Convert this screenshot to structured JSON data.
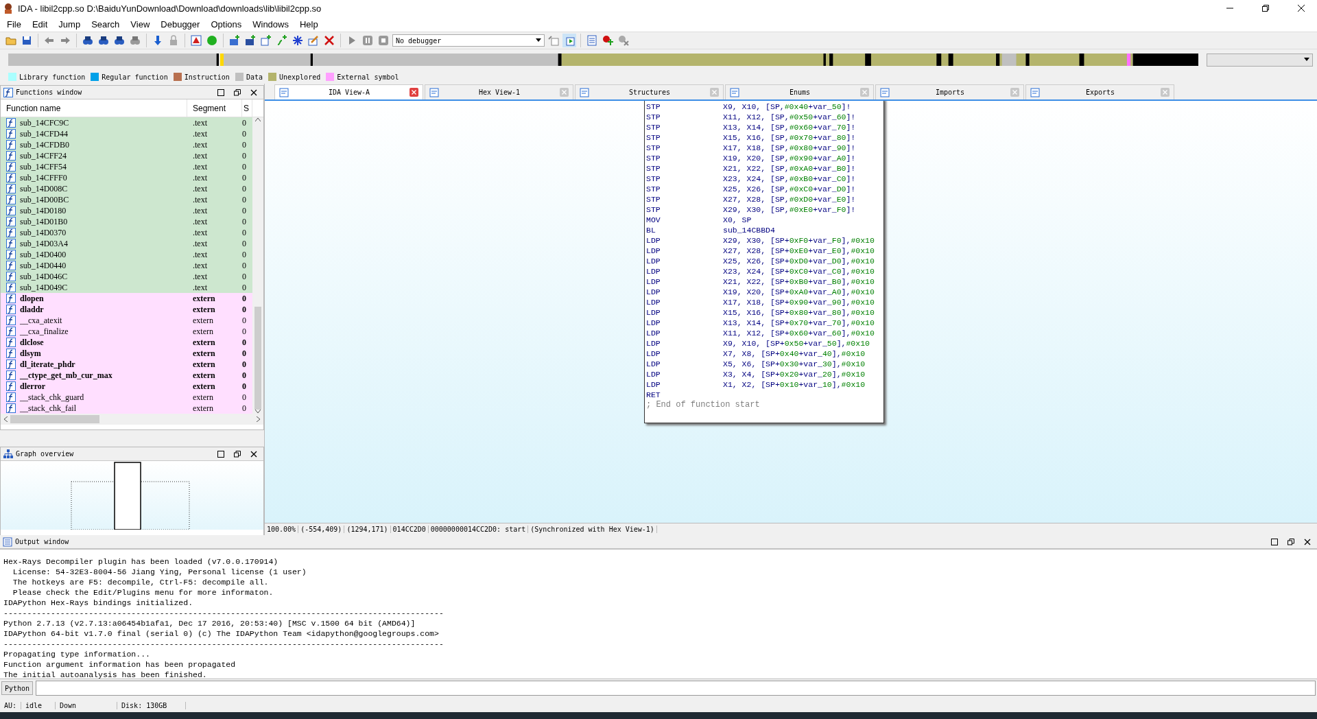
{
  "window": {
    "title": "IDA - libil2cpp.so D:\\BaiduYunDownload\\Download\\downloads\\lib\\libil2cpp.so"
  },
  "menu": [
    "File",
    "Edit",
    "Jump",
    "Search",
    "View",
    "Debugger",
    "Options",
    "Windows",
    "Help"
  ],
  "toolbar": {
    "debugger_select": "No debugger"
  },
  "legend": [
    {
      "label": "Library function",
      "color": "#aaffff"
    },
    {
      "label": "Regular function",
      "color": "#00a0e8"
    },
    {
      "label": "Instruction",
      "color": "#b87050"
    },
    {
      "label": "Data",
      "color": "#c0c0c0"
    },
    {
      "label": "Unexplored",
      "color": "#b4b46c"
    },
    {
      "label": "External symbol",
      "color": "#ffa0ff"
    }
  ],
  "functions_window": {
    "title": "Functions window",
    "columns": [
      "Function name",
      "Segment",
      "S"
    ],
    "rows": [
      {
        "name": "sub_14CFC9C",
        "segment": ".text",
        "column_3": "0",
        "kind": "code",
        "bold": false
      },
      {
        "name": "sub_14CFD44",
        "segment": ".text",
        "column_3": "0",
        "kind": "code",
        "bold": false
      },
      {
        "name": "sub_14CFDB0",
        "segment": ".text",
        "column_3": "0",
        "kind": "code",
        "bold": false
      },
      {
        "name": "sub_14CFF24",
        "segment": ".text",
        "column_3": "0",
        "kind": "code",
        "bold": false
      },
      {
        "name": "sub_14CFF54",
        "segment": ".text",
        "column_3": "0",
        "kind": "code",
        "bold": false
      },
      {
        "name": "sub_14CFFF0",
        "segment": ".text",
        "column_3": "0",
        "kind": "code",
        "bold": false
      },
      {
        "name": "sub_14D008C",
        "segment": ".text",
        "column_3": "0",
        "kind": "code",
        "bold": false
      },
      {
        "name": "sub_14D00BC",
        "segment": ".text",
        "column_3": "0",
        "kind": "code",
        "bold": false
      },
      {
        "name": "sub_14D0180",
        "segment": ".text",
        "column_3": "0",
        "kind": "code",
        "bold": false
      },
      {
        "name": "sub_14D01B0",
        "segment": ".text",
        "column_3": "0",
        "kind": "code",
        "bold": false
      },
      {
        "name": "sub_14D0370",
        "segment": ".text",
        "column_3": "0",
        "kind": "code",
        "bold": false
      },
      {
        "name": "sub_14D03A4",
        "segment": ".text",
        "column_3": "0",
        "kind": "code",
        "bold": false
      },
      {
        "name": "sub_14D0400",
        "segment": ".text",
        "column_3": "0",
        "kind": "code",
        "bold": false
      },
      {
        "name": "sub_14D0440",
        "segment": ".text",
        "column_3": "0",
        "kind": "code",
        "bold": false
      },
      {
        "name": "sub_14D046C",
        "segment": ".text",
        "column_3": "0",
        "kind": "code",
        "bold": false
      },
      {
        "name": "sub_14D049C",
        "segment": ".text",
        "column_3": "0",
        "kind": "code",
        "bold": false
      },
      {
        "name": "dlopen",
        "segment": "extern",
        "column_3": "0",
        "kind": "extern",
        "bold": true
      },
      {
        "name": "dladdr",
        "segment": "extern",
        "column_3": "0",
        "kind": "extern",
        "bold": true
      },
      {
        "name": "__cxa_atexit",
        "segment": "extern",
        "column_3": "0",
        "kind": "extern",
        "bold": false
      },
      {
        "name": "__cxa_finalize",
        "segment": "extern",
        "column_3": "0",
        "kind": "extern",
        "bold": false
      },
      {
        "name": "dlclose",
        "segment": "extern",
        "column_3": "0",
        "kind": "extern",
        "bold": true
      },
      {
        "name": "dlsym",
        "segment": "extern",
        "column_3": "0",
        "kind": "extern",
        "bold": true
      },
      {
        "name": "dl_iterate_phdr",
        "segment": "extern",
        "column_3": "0",
        "kind": "extern",
        "bold": true
      },
      {
        "name": "__ctype_get_mb_cur_max",
        "segment": "extern",
        "column_3": "0",
        "kind": "extern",
        "bold": true
      },
      {
        "name": "dlerror",
        "segment": "extern",
        "column_3": "0",
        "kind": "extern",
        "bold": true
      },
      {
        "name": "__stack_chk_guard",
        "segment": "extern",
        "column_3": "0",
        "kind": "extern",
        "bold": false
      },
      {
        "name": "__stack_chk_fail",
        "segment": "extern",
        "column_3": "0",
        "kind": "extern",
        "bold": false
      }
    ]
  },
  "graph_overview": {
    "title": "Graph overview"
  },
  "tabs": [
    {
      "label": "IDA View-A",
      "selected": true
    },
    {
      "label": "Hex View-1",
      "selected": false
    },
    {
      "label": "Structures",
      "selected": false
    },
    {
      "label": "Enums",
      "selected": false
    },
    {
      "label": "Imports",
      "selected": false
    },
    {
      "label": "Exports",
      "selected": false
    }
  ],
  "code": [
    {
      "mnemonic": "STP",
      "operands": [
        "X9, X10, [SP,",
        "#0x40",
        "+var_",
        "50",
        "]!"
      ]
    },
    {
      "mnemonic": "STP",
      "operands": [
        "X11, X12, [SP,",
        "#0x50",
        "+var_",
        "60",
        "]!"
      ]
    },
    {
      "mnemonic": "STP",
      "operands": [
        "X13, X14, [SP,",
        "#0x60",
        "+var_",
        "70",
        "]!"
      ]
    },
    {
      "mnemonic": "STP",
      "operands": [
        "X15, X16, [SP,",
        "#0x70",
        "+var_",
        "80",
        "]!"
      ]
    },
    {
      "mnemonic": "STP",
      "operands": [
        "X17, X18, [SP,",
        "#0x80",
        "+var_",
        "90",
        "]!"
      ]
    },
    {
      "mnemonic": "STP",
      "operands": [
        "X19, X20, [SP,",
        "#0x90",
        "+var_",
        "A0",
        "]!"
      ]
    },
    {
      "mnemonic": "STP",
      "operands": [
        "X21, X22, [SP,",
        "#0xA0",
        "+var_",
        "B0",
        "]!"
      ]
    },
    {
      "mnemonic": "STP",
      "operands": [
        "X23, X24, [SP,",
        "#0xB0",
        "+var_",
        "C0",
        "]!"
      ]
    },
    {
      "mnemonic": "STP",
      "operands": [
        "X25, X26, [SP,",
        "#0xC0",
        "+var_",
        "D0",
        "]!"
      ]
    },
    {
      "mnemonic": "STP",
      "operands": [
        "X27, X28, [SP,",
        "#0xD0",
        "+var_",
        "E0",
        "]!"
      ]
    },
    {
      "mnemonic": "STP",
      "operands": [
        "X29, X30, [SP,",
        "#0xE0",
        "+var_",
        "F0",
        "]!"
      ]
    },
    {
      "mnemonic": "MOV",
      "operands": [
        "X0, SP"
      ]
    },
    {
      "mnemonic": "BL",
      "operands": [
        "sub_14CBBD4"
      ]
    },
    {
      "mnemonic": "LDP",
      "operands": [
        "X29, X30, [SP+",
        "0xF0",
        "+var_",
        "F0",
        "],",
        "#0x10"
      ]
    },
    {
      "mnemonic": "LDP",
      "operands": [
        "X27, X28, [SP+",
        "0xE0",
        "+var_",
        "E0",
        "],",
        "#0x10"
      ]
    },
    {
      "mnemonic": "LDP",
      "operands": [
        "X25, X26, [SP+",
        "0xD0",
        "+var_",
        "D0",
        "],",
        "#0x10"
      ]
    },
    {
      "mnemonic": "LDP",
      "operands": [
        "X23, X24, [SP+",
        "0xC0",
        "+var_",
        "C0",
        "],",
        "#0x10"
      ]
    },
    {
      "mnemonic": "LDP",
      "operands": [
        "X21, X22, [SP+",
        "0xB0",
        "+var_",
        "B0",
        "],",
        "#0x10"
      ]
    },
    {
      "mnemonic": "LDP",
      "operands": [
        "X19, X20, [SP+",
        "0xA0",
        "+var_",
        "A0",
        "],",
        "#0x10"
      ]
    },
    {
      "mnemonic": "LDP",
      "operands": [
        "X17, X18, [SP+",
        "0x90",
        "+var_",
        "90",
        "],",
        "#0x10"
      ]
    },
    {
      "mnemonic": "LDP",
      "operands": [
        "X15, X16, [SP+",
        "0x80",
        "+var_",
        "80",
        "],",
        "#0x10"
      ]
    },
    {
      "mnemonic": "LDP",
      "operands": [
        "X13, X14, [SP+",
        "0x70",
        "+var_",
        "70",
        "],",
        "#0x10"
      ]
    },
    {
      "mnemonic": "LDP",
      "operands": [
        "X11, X12, [SP+",
        "0x60",
        "+var_",
        "60",
        "],",
        "#0x10"
      ]
    },
    {
      "mnemonic": "LDP",
      "operands": [
        "X9, X10, [SP+",
        "0x50",
        "+var_",
        "50",
        "],",
        "#0x10"
      ]
    },
    {
      "mnemonic": "LDP",
      "operands": [
        "X7, X8, [SP+",
        "0x40",
        "+var_",
        "40",
        "],",
        "#0x10"
      ]
    },
    {
      "mnemonic": "LDP",
      "operands": [
        "X5, X6, [SP+",
        "0x30",
        "+var_",
        "30",
        "],",
        "#0x10"
      ]
    },
    {
      "mnemonic": "LDP",
      "operands": [
        "X3, X4, [SP+",
        "0x20",
        "+var_",
        "20",
        "],",
        "#0x10"
      ]
    },
    {
      "mnemonic": "LDP",
      "operands": [
        "X1, X2, [SP+",
        "0x10",
        "+var_",
        "10",
        "],",
        "#0x10"
      ]
    },
    {
      "mnemonic": "RET"
    }
  ],
  "code_comment": "; End of function start",
  "graph_status": [
    "100.00%",
    "(-554,409)",
    "(1294,171)",
    "014CC2D0",
    "00000000014CC2D0: start",
    "(Synchronized with Hex View-1)"
  ],
  "output_window": {
    "title": "Output window",
    "lines": [
      "Hex-Rays Decompiler plugin has been loaded (v7.0.0.170914)",
      "  License: 54-32E3-8004-56 Jiang Ying, Personal license (1 user)",
      "  The hotkeys are F5: decompile, Ctrl-F5: decompile all.",
      "  Please check the Edit/Plugins menu for more informaton.",
      "IDAPython Hex-Rays bindings initialized.",
      "---------------------------------------------------------------------------------------------",
      "Python 2.7.13 (v2.7.13:a06454b1afa1, Dec 17 2016, 20:53:40) [MSC v.1500 64 bit (AMD64)]",
      "IDAPython 64-bit v1.7.0 final (serial 0) (c) The IDAPython Team <idapython@googlegroups.com>",
      "---------------------------------------------------------------------------------------------",
      "Propagating type information...",
      "Function argument information has been propagated",
      "The initial autoanalysis has been finished."
    ]
  },
  "command_line": {
    "language": "Python"
  },
  "status_bar": [
    "AU:",
    "idle",
    "Down",
    "Disk: 130GB"
  ]
}
